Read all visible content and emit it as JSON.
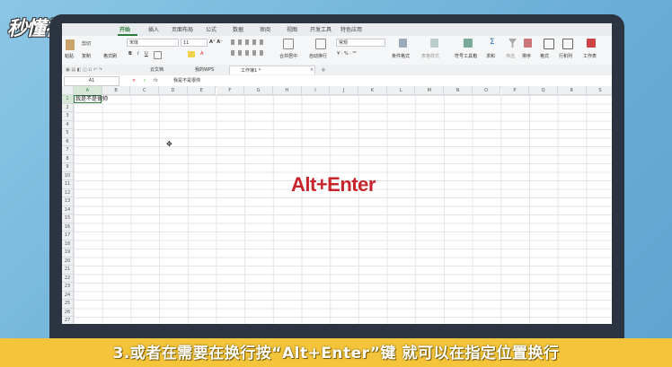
{
  "branding": {
    "logo": "秒懂视频"
  },
  "menu_tabs": [
    "开始",
    "插入",
    "页面布局",
    "公式",
    "数据",
    "审阅",
    "视图",
    "开发工具",
    "特色应用"
  ],
  "active_tab": "开始",
  "ribbon": {
    "paste": "粘贴",
    "cut": "剪切",
    "copy": "复制",
    "format_painter": "格式刷",
    "font_name": "宋体",
    "font_size": "11",
    "merge_center": "合并居中",
    "wrap_text": "自动换行",
    "number_format": "常规",
    "conditional_format": "条件格式",
    "table_style": "表格样式",
    "symbols": "符号工具箱",
    "sum": "求和",
    "filter": "筛选",
    "sort": "排序",
    "format": "格式",
    "rows_cols": "行和列",
    "worksheet": "工作表"
  },
  "doc_tabs": [
    {
      "label": "云文档"
    },
    {
      "label": "我的WPS"
    },
    {
      "label": "工作簿1 *"
    }
  ],
  "formula_bar": {
    "name_box": "A1",
    "fx": "fx",
    "content": "我是不是很帅"
  },
  "columns": [
    "A",
    "B",
    "C",
    "D",
    "E",
    "F",
    "G",
    "H",
    "I",
    "J",
    "K",
    "L",
    "M",
    "N",
    "O",
    "P",
    "Q",
    "R",
    "S"
  ],
  "rows": [
    "1",
    "2",
    "3",
    "4",
    "5",
    "6",
    "7",
    "8",
    "9",
    "10",
    "11",
    "12",
    "13",
    "14",
    "15",
    "16",
    "17",
    "18",
    "19",
    "20",
    "21",
    "22",
    "23",
    "24",
    "25",
    "26",
    "27"
  ],
  "cell_a1": "我是不是很帅",
  "overlay_text": "Alt+Enter",
  "caption": "3.或者在需要在换行按“Alt+Enter”键 就可以在指定位置换行"
}
